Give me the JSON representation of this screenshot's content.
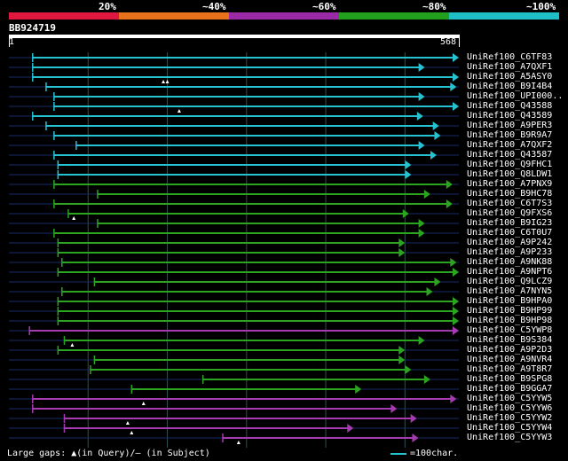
{
  "legend": [
    {
      "label": "20%",
      "color": "#e01840"
    },
    {
      "label": "~40%",
      "color": "#e8721c"
    },
    {
      "label": "~60%",
      "color": "#9a2aa6"
    },
    {
      "label": "~80%",
      "color": "#22a01e"
    },
    {
      "label": "~100%",
      "color": "#1fbfc8"
    }
  ],
  "query": {
    "name": "BB924719",
    "start": "1",
    "end": "568"
  },
  "query_length": 568,
  "hits": [
    {
      "name": "UniRef100_C6TF83",
      "start": 30,
      "end": 568,
      "color": "cyan",
      "gaps": []
    },
    {
      "name": "UniRef100_A7QXF1",
      "start": 30,
      "end": 525,
      "color": "cyan",
      "gaps": []
    },
    {
      "name": "UniRef100_A5ASY0",
      "start": 30,
      "end": 568,
      "color": "cyan",
      "gaps": [
        195,
        200
      ]
    },
    {
      "name": "UniRef100_B9I4B4",
      "start": 47,
      "end": 565,
      "color": "cyan",
      "gaps": []
    },
    {
      "name": "UniRef100_UPI000..",
      "start": 57,
      "end": 525,
      "color": "cyan",
      "gaps": []
    },
    {
      "name": "UniRef100_Q43588",
      "start": 57,
      "end": 568,
      "color": "cyan",
      "gaps": [
        215
      ]
    },
    {
      "name": "UniRef100_Q43589",
      "start": 30,
      "end": 523,
      "color": "cyan",
      "gaps": []
    },
    {
      "name": "UniRef100_A9PER3",
      "start": 47,
      "end": 543,
      "color": "cyan",
      "gaps": []
    },
    {
      "name": "UniRef100_B9R9A7",
      "start": 57,
      "end": 545,
      "color": "cyan",
      "gaps": []
    },
    {
      "name": "UniRef100_A7QXF2",
      "start": 85,
      "end": 525,
      "color": "cyan",
      "gaps": []
    },
    {
      "name": "UniRef100_Q43587",
      "start": 57,
      "end": 540,
      "color": "cyan",
      "gaps": []
    },
    {
      "name": "UniRef100_Q9FHC1",
      "start": 62,
      "end": 508,
      "color": "cyan",
      "gaps": []
    },
    {
      "name": "UniRef100_Q8LDW1",
      "start": 62,
      "end": 508,
      "color": "cyan",
      "gaps": []
    },
    {
      "name": "UniRef100_A7PNX9",
      "start": 57,
      "end": 560,
      "color": "green",
      "gaps": []
    },
    {
      "name": "UniRef100_B9HC78",
      "start": 112,
      "end": 532,
      "color": "green",
      "gaps": []
    },
    {
      "name": "UniRef100_C6T7S3",
      "start": 57,
      "end": 560,
      "color": "green",
      "gaps": []
    },
    {
      "name": "UniRef100_Q9FXS6",
      "start": 75,
      "end": 505,
      "color": "green",
      "gaps": [
        82
      ]
    },
    {
      "name": "UniRef100_B9IG23",
      "start": 112,
      "end": 525,
      "color": "green",
      "gaps": []
    },
    {
      "name": "UniRef100_C6T0U7",
      "start": 57,
      "end": 525,
      "color": "green",
      "gaps": []
    },
    {
      "name": "UniRef100_A9P242",
      "start": 62,
      "end": 500,
      "color": "green",
      "gaps": []
    },
    {
      "name": "UniRef100_A9P233",
      "start": 62,
      "end": 500,
      "color": "green",
      "gaps": []
    },
    {
      "name": "UniRef100_A9NK88",
      "start": 67,
      "end": 565,
      "color": "green",
      "gaps": []
    },
    {
      "name": "UniRef100_A9NPT6",
      "start": 62,
      "end": 568,
      "color": "green",
      "gaps": []
    },
    {
      "name": "UniRef100_Q9LCZ9",
      "start": 108,
      "end": 545,
      "color": "green",
      "gaps": []
    },
    {
      "name": "UniRef100_A7NYN5",
      "start": 67,
      "end": 535,
      "color": "green",
      "gaps": []
    },
    {
      "name": "UniRef100_B9HPA0",
      "start": 62,
      "end": 568,
      "color": "green",
      "gaps": []
    },
    {
      "name": "UniRef100_B9HP99",
      "start": 62,
      "end": 568,
      "color": "green",
      "gaps": []
    },
    {
      "name": "UniRef100_B9HP98",
      "start": 62,
      "end": 568,
      "color": "green",
      "gaps": []
    },
    {
      "name": "UniRef100_C5YWP8",
      "start": 26,
      "end": 568,
      "color": "purple",
      "gaps": []
    },
    {
      "name": "UniRef100_B9S384",
      "start": 70,
      "end": 525,
      "color": "green",
      "gaps": [
        80
      ]
    },
    {
      "name": "UniRef100_A9P2D3",
      "start": 62,
      "end": 500,
      "color": "green",
      "gaps": []
    },
    {
      "name": "UniRef100_A9NVR4",
      "start": 108,
      "end": 500,
      "color": "green",
      "gaps": []
    },
    {
      "name": "UniRef100_A9T8R7",
      "start": 103,
      "end": 508,
      "color": "green",
      "gaps": []
    },
    {
      "name": "UniRef100_B9SPG8",
      "start": 245,
      "end": 532,
      "color": "green",
      "gaps": []
    },
    {
      "name": "UniRef100_B9GGA7",
      "start": 155,
      "end": 445,
      "color": "green",
      "gaps": []
    },
    {
      "name": "UniRef100_C5YYW5",
      "start": 30,
      "end": 565,
      "color": "purple",
      "gaps": [
        170
      ]
    },
    {
      "name": "UniRef100_C5YYW6",
      "start": 30,
      "end": 490,
      "color": "purple",
      "gaps": []
    },
    {
      "name": "UniRef100_C5YYW2",
      "start": 70,
      "end": 515,
      "color": "purple",
      "gaps": [
        150
      ]
    },
    {
      "name": "UniRef100_C5YYW4",
      "start": 70,
      "end": 435,
      "color": "purple",
      "gaps": [
        155
      ]
    },
    {
      "name": "UniRef100_C5YYW3",
      "start": 270,
      "end": 517,
      "color": "purple",
      "gaps": [
        290
      ]
    }
  ],
  "colors": {
    "cyan": "#25c2d2",
    "green": "#2ba51f",
    "purple": "#a63ab0",
    "grid": "#2f4f4f",
    "baseline": "#1a2a6a"
  },
  "footer": {
    "text": "Large gaps: ▲(in Query)/– (in Subject)"
  },
  "scale": {
    "label": "=100char."
  }
}
